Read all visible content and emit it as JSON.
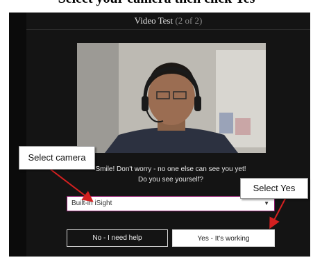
{
  "heading": "Select your camera then click Yes",
  "dialog": {
    "title": "Video Test",
    "step": "(2 of 2)",
    "message_line1": "Smile! Don't worry - no one else can see you yet!",
    "message_line2": "Do you see yourself?"
  },
  "camera_select": {
    "value": "Built-in iSight",
    "arrow_icon": "▼"
  },
  "buttons": {
    "no_label": "No - I need help",
    "yes_label": "Yes - It's working"
  },
  "callouts": {
    "camera": "Select camera",
    "yes": "Select Yes"
  },
  "colors": {
    "arrow": "#d42020",
    "select_border": "#8e1e6e",
    "panel": "#141414"
  }
}
